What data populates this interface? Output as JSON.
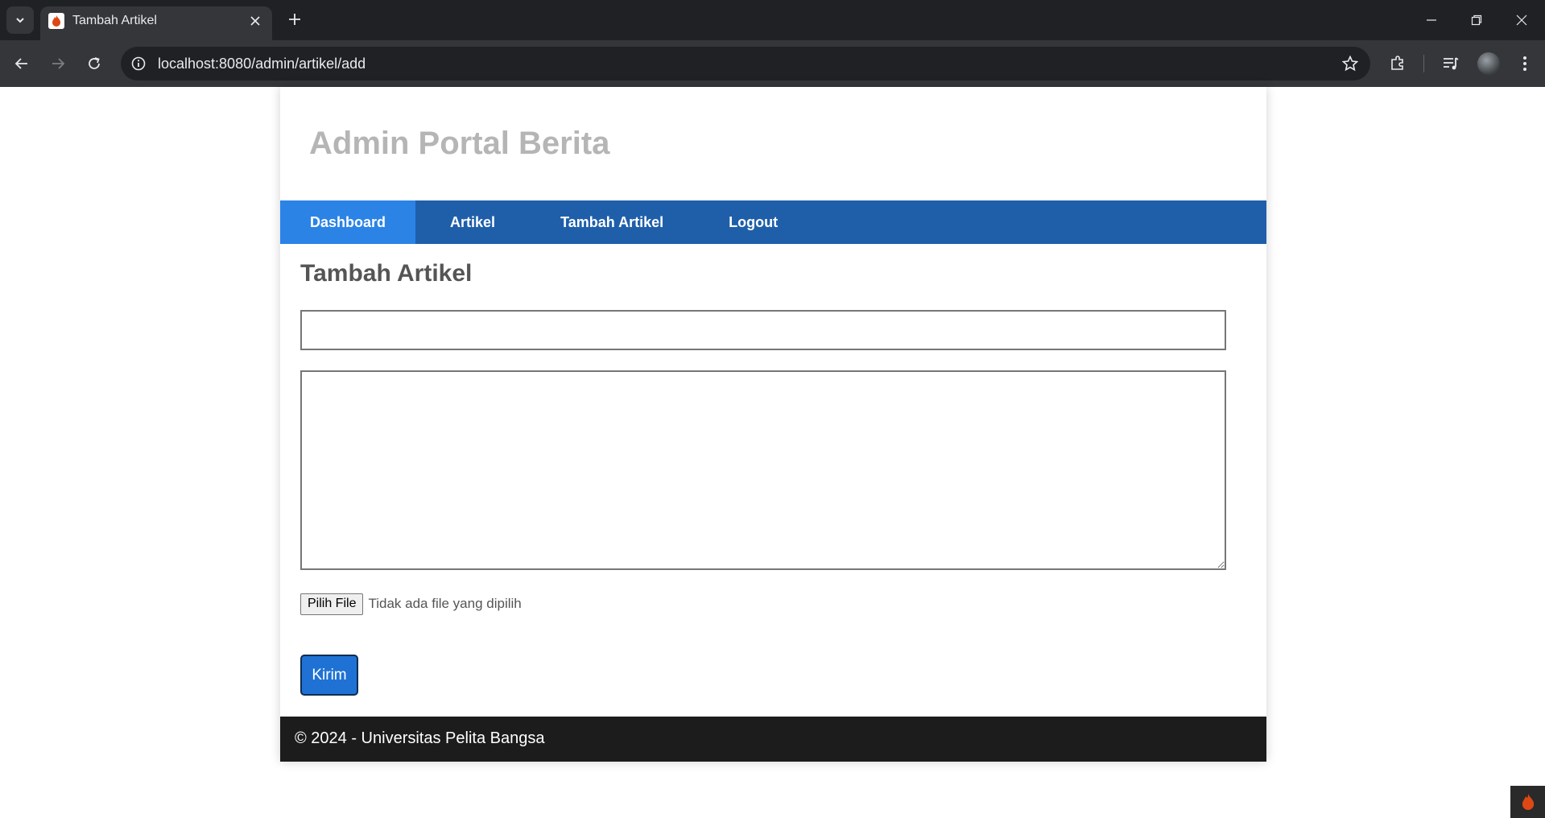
{
  "browser": {
    "tab_title": "Tambah Artikel",
    "url": "localhost:8080/admin/artikel/add",
    "icons": [
      "tab-search-icon",
      "favicon-icon",
      "close-icon",
      "plus-icon",
      "minimize-icon",
      "restore-icon",
      "window-close-icon",
      "back-icon",
      "forward-icon",
      "reload-icon",
      "info-icon",
      "star-icon",
      "extensions-icon",
      "media-icon",
      "avatar"
    ]
  },
  "site": {
    "title": "Admin Portal Berita"
  },
  "nav": {
    "items": [
      {
        "label": "Dashboard",
        "active": true
      },
      {
        "label": "Artikel",
        "active": false
      },
      {
        "label": "Tambah Artikel",
        "active": false
      },
      {
        "label": "Logout",
        "active": false
      }
    ]
  },
  "form": {
    "heading": "Tambah Artikel",
    "title_value": "",
    "content_value": "",
    "file_button_label": "Pilih File",
    "file_status": "Tidak ada file yang dipilih",
    "submit_label": "Kirim"
  },
  "footer": {
    "text": "© 2024 - Universitas Pelita Bangsa"
  },
  "colors": {
    "nav_bg": "#1f5faa",
    "nav_active": "#2b83e6",
    "submit_bg": "#1f72d4",
    "footer_bg": "#1c1c1c",
    "title_color": "#b5b5b5"
  }
}
